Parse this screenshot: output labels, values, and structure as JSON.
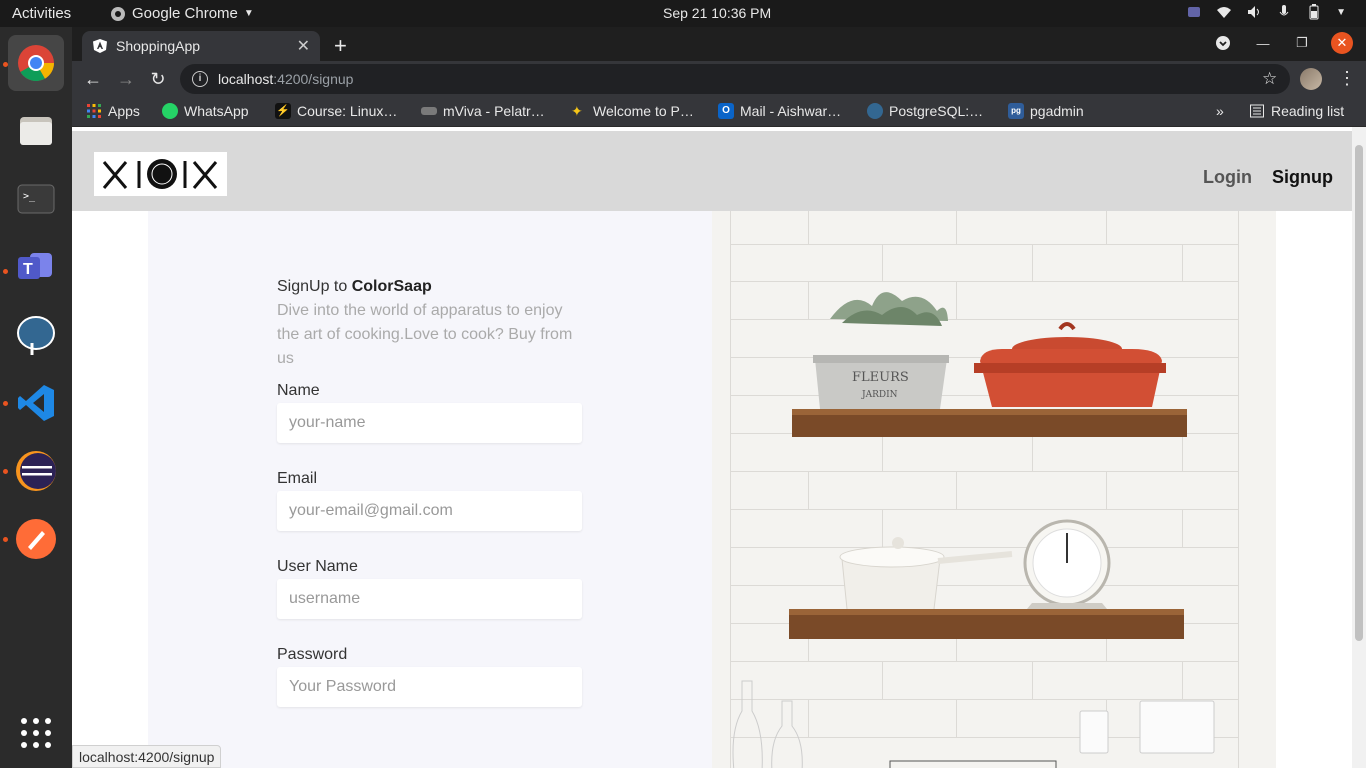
{
  "system_bar": {
    "activities": "Activities",
    "app_name": "Google Chrome",
    "clock": "Sep 21  10:36 PM"
  },
  "browser": {
    "tab_title": "ShoppingApp",
    "url_host": "localhost",
    "url_path": ":4200/signup",
    "bookmarks": [
      {
        "label": "Apps",
        "color": "#e0543a"
      },
      {
        "label": "WhatsApp",
        "color": "#25d366"
      },
      {
        "label": "Course: Linux…",
        "color": "#111111"
      },
      {
        "label": "mViva - Pelatr…",
        "color": "#7a7a7a"
      },
      {
        "label": "Welcome to P…",
        "color": "#f5c518"
      },
      {
        "label": "Mail - Aishwar…",
        "color": "#0a64c8"
      },
      {
        "label": "PostgreSQL:…",
        "color": "#336791"
      },
      {
        "label": "pgadmin",
        "color": "#2f5d9a"
      }
    ],
    "reading_list": "Reading list",
    "status_url": "localhost:4200/signup"
  },
  "navbar": {
    "login": "Login",
    "signup": "Signup"
  },
  "form": {
    "heading_prefix": "SignUp to ",
    "heading_brand": "ColorSaap",
    "subtext": "Dive into the world of apparatus to enjoy the art of cooking.Love to cook? Buy from us",
    "fields": [
      {
        "label": "Name",
        "placeholder": "your-name"
      },
      {
        "label": "Email",
        "placeholder": "your-email@gmail.com"
      },
      {
        "label": "User Name",
        "placeholder": "username"
      },
      {
        "label": "Password",
        "placeholder": "Your Password"
      }
    ]
  },
  "image": {
    "pot_text": "FLEURS & JARDIN"
  },
  "colors": {
    "accent_close": "#e95420",
    "navbar_bg": "#d9d9d9",
    "panel_bg": "#f6f6fb"
  }
}
